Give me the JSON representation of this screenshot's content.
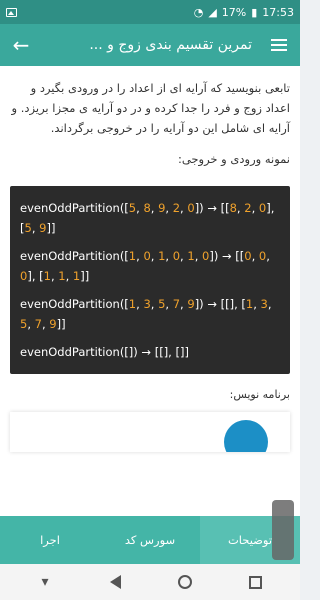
{
  "status_bar": {
    "battery": "17%",
    "time": "17:53"
  },
  "app_bar": {
    "title": "تمرین تقسیم بندی زوج و ...",
    "back_icon": "arrow-left-icon",
    "menu_icon": "hamburger-menu-icon"
  },
  "content": {
    "description": "تابعی بنویسید که آرایه ای از اعداد را در ورودی بگیرد و اعداد زوج و فرد را جدا کرده و در دو آرایه ی مجزا بریزد. و آرایه ای شامل این دو آرایه را در خروجی برگرداند.",
    "io_title": "نمونه ورودی و خروجی:",
    "writer_label": "برنامه نویس:"
  },
  "code_examples": [
    "evenOddPartition([5, 8, 9, 2, 0]) → [[8, 2, 0], [5, 9]]",
    "evenOddPartition([1, 0, 1, 0, 1, 0]) → [[0, 0, 0], [1, 1, 1]]",
    "evenOddPartition([1, 3, 5, 7, 9]) → [[], [1, 3, 5, 7, 9]]",
    "evenOddPartition([]) → [[], []]"
  ],
  "tabs": [
    {
      "label": "توضیحات",
      "active": true
    },
    {
      "label": "سورس کد",
      "active": false
    },
    {
      "label": "اجرا",
      "active": false
    }
  ],
  "colors": {
    "appbar": "#3aa89c",
    "statusbar": "#2f8f85",
    "tabs": "#44b5a7",
    "code_bg": "#2b2b2b",
    "code_number": "#f0a22c"
  }
}
